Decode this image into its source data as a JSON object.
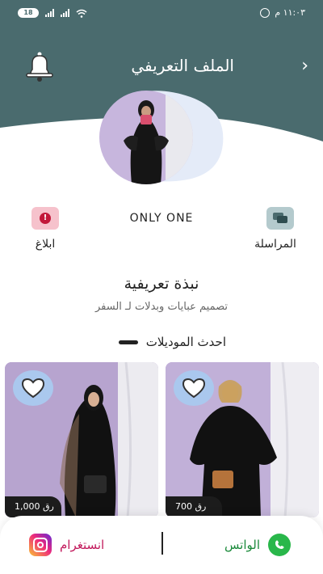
{
  "status_bar": {
    "battery": "18",
    "time": "١١:٠٣ م"
  },
  "header": {
    "title": "الملف التعريفي",
    "back_icon": "chevron-right-icon",
    "bell_icon": "bell-icon",
    "color": "#4a6b6e"
  },
  "profile": {
    "store_name": "ONLY ONE",
    "report_label": "ابلاغ",
    "chat_label": "المراسلة"
  },
  "bio": {
    "title": "نبذة تعريفية",
    "text": "تصميم عبايات وبدلات لـ السفر"
  },
  "latest": {
    "heading": "احدث الموديلات",
    "products": [
      {
        "price": "1,000 رق",
        "favorite_icon": "heart-icon"
      },
      {
        "price": "700 رق",
        "favorite_icon": "heart-icon"
      }
    ]
  },
  "bottom_bar": {
    "whatsapp_label": "الواتس",
    "instagram_label": "انستغرام"
  },
  "colors": {
    "accent": "#4a6b6e",
    "report": "#f6c2cc",
    "chat": "#b4cacd",
    "whatsapp": "#29b74a",
    "instagram": "#c2185b"
  }
}
